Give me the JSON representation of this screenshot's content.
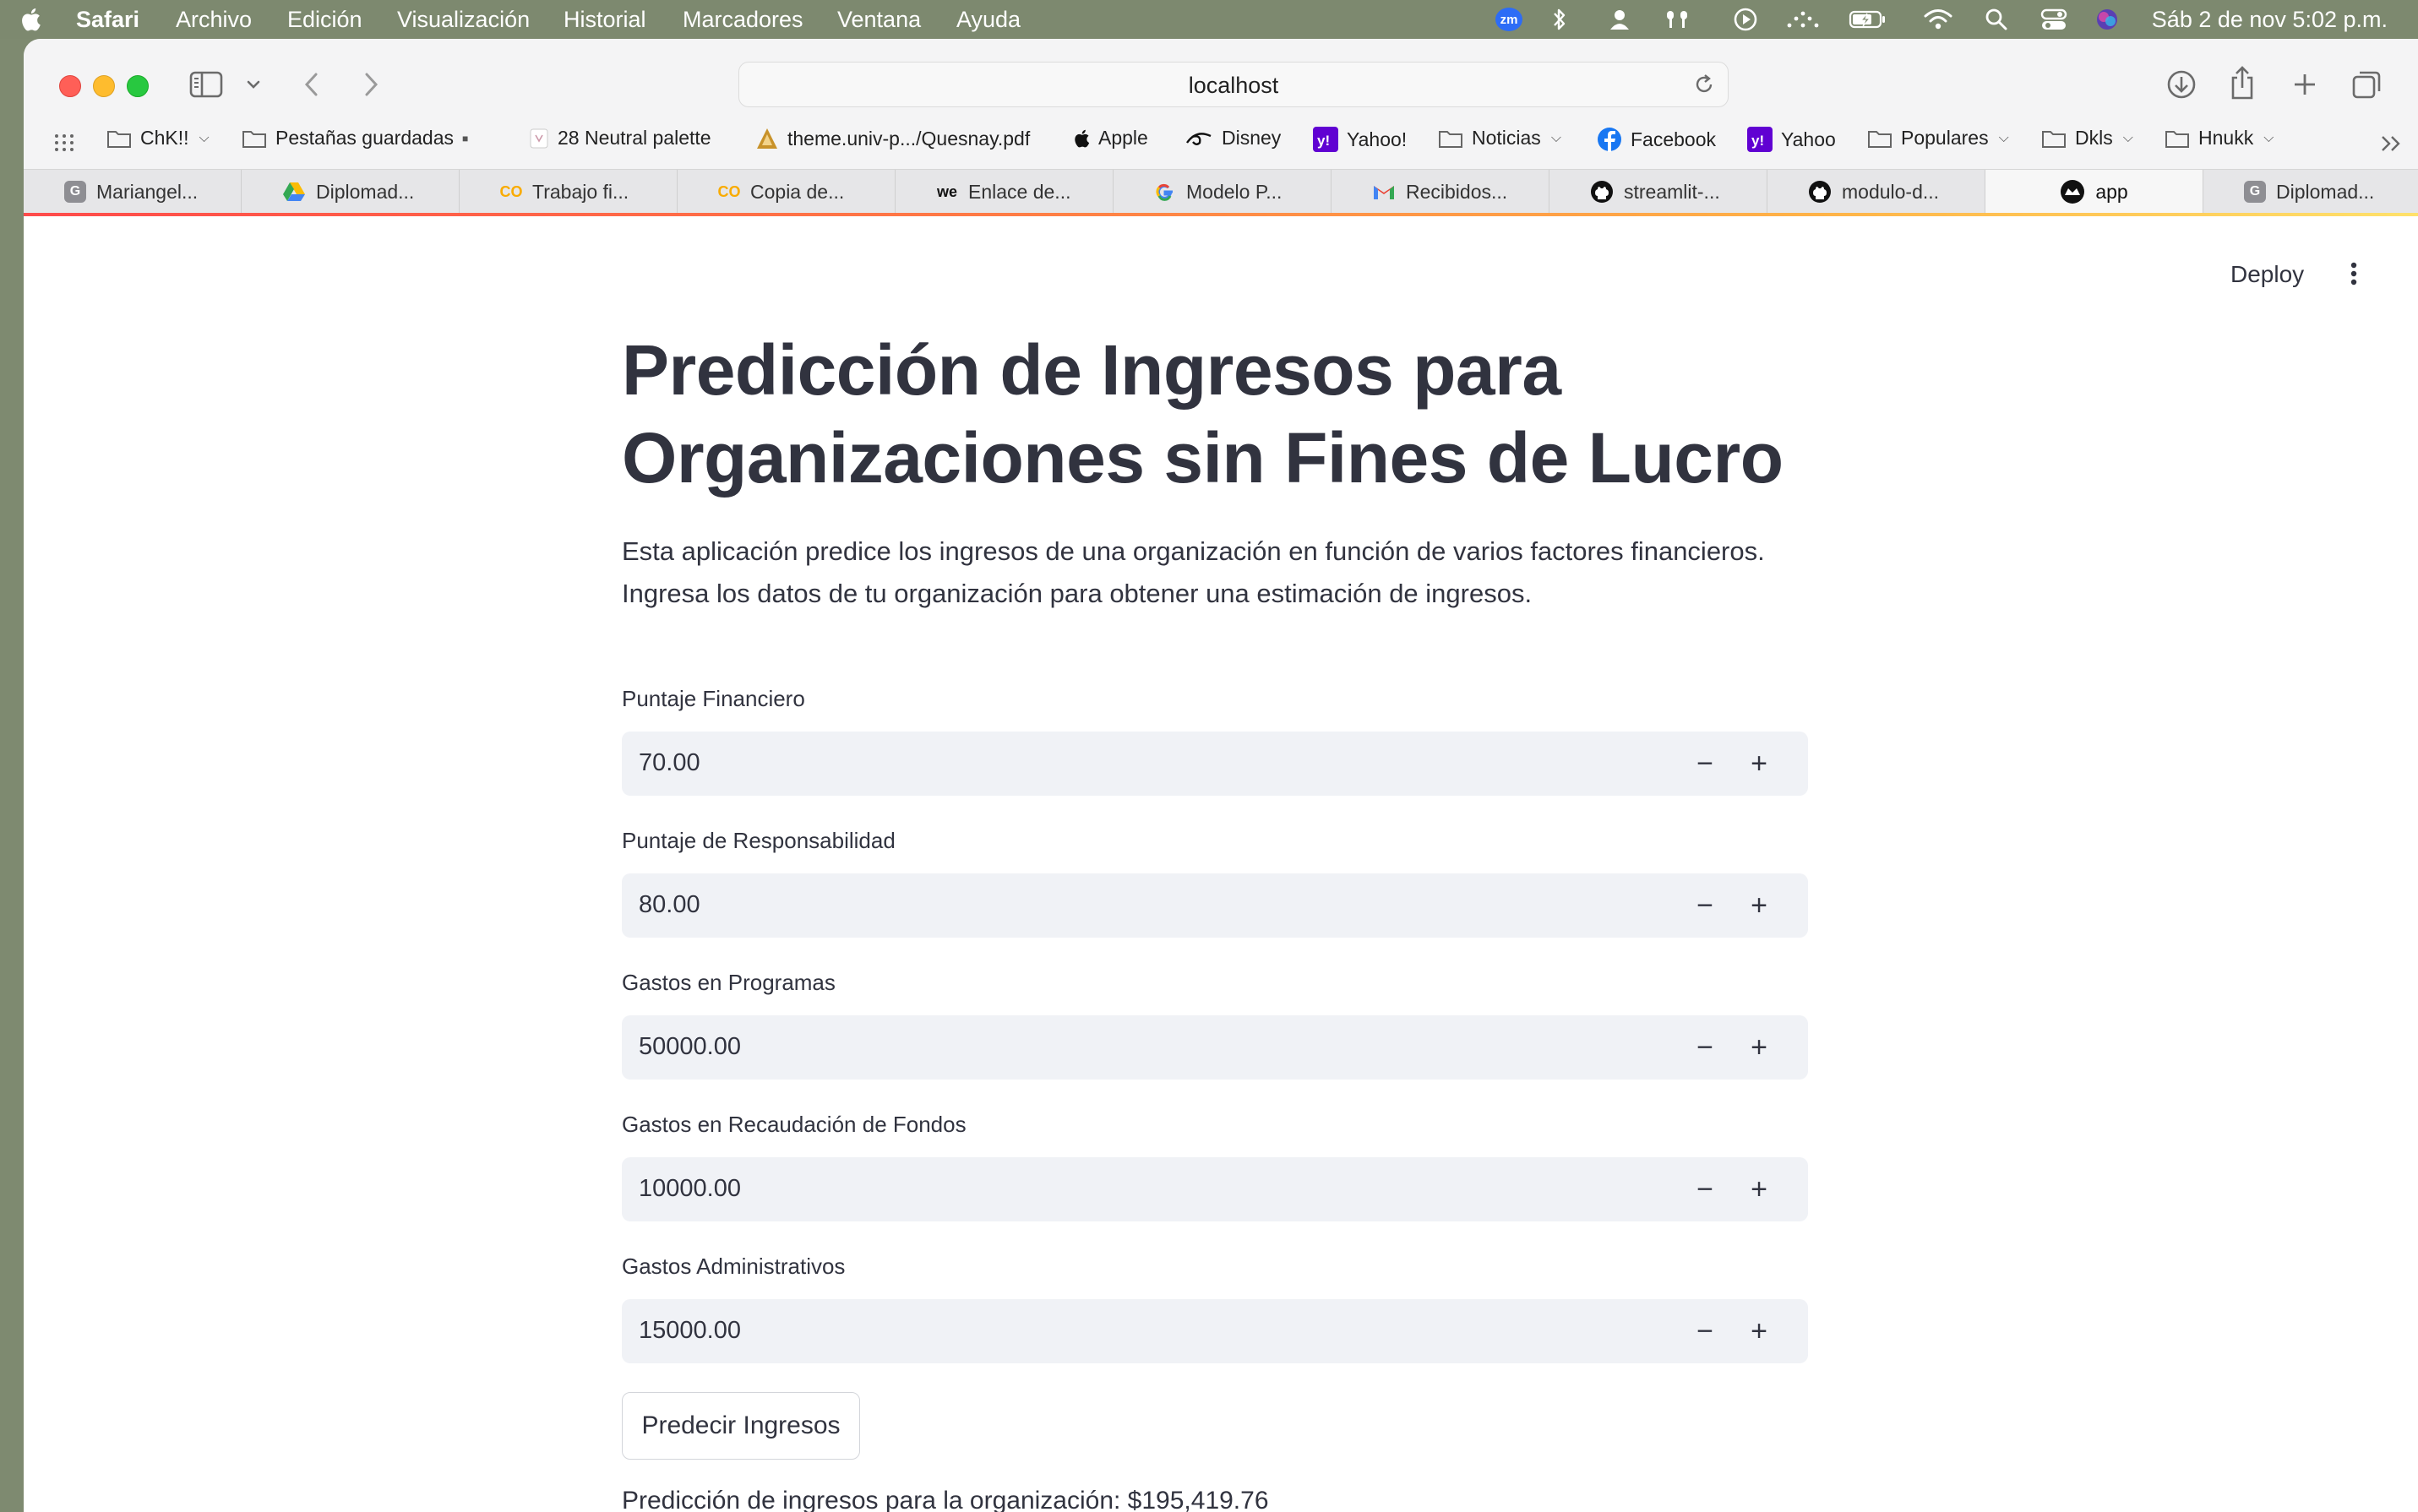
{
  "menubar": {
    "items": [
      "Safari",
      "Archivo",
      "Edición",
      "Visualización",
      "Historial",
      "Marcadores",
      "Ventana",
      "Ayuda"
    ],
    "status_icons": [
      "zoom-icon",
      "bluetooth-icon",
      "user-icon",
      "airpods-icon",
      "play-icon",
      "wifi-dots-icon",
      "battery-icon",
      "wifi-icon",
      "search-icon",
      "control-center-icon",
      "siri-icon"
    ],
    "zoom_badge": "zm",
    "clock": "Sáb 2 de nov  5:02 p.m."
  },
  "browser": {
    "url": "localhost",
    "bookmarks": [
      {
        "label": "ChK!!",
        "icon": "folder-icon",
        "menu": true
      },
      {
        "label": "Pestañas guardadas",
        "icon": "folder-icon",
        "menu": false
      },
      {
        "label": "28 Neutral palette",
        "icon": "palette-icon",
        "menu": false
      },
      {
        "label": "theme.univ-p.../Quesnay.pdf",
        "icon": "pdf-icon",
        "menu": false
      },
      {
        "label": "Apple",
        "icon": "apple-icon",
        "menu": false
      },
      {
        "label": "Disney",
        "icon": "disney-icon",
        "menu": false
      },
      {
        "label": "Yahoo!",
        "icon": "yahoo-icon",
        "menu": false
      },
      {
        "label": "Noticias",
        "icon": "folder-icon",
        "menu": true
      },
      {
        "label": "Facebook",
        "icon": "facebook-icon",
        "menu": false
      },
      {
        "label": "Yahoo",
        "icon": "yahoo-icon",
        "menu": false
      },
      {
        "label": "Populares",
        "icon": "folder-icon",
        "menu": true
      },
      {
        "label": "Dkls",
        "icon": "folder-icon",
        "menu": true
      },
      {
        "label": "Hnukk",
        "icon": "folder-icon",
        "menu": true
      }
    ],
    "tabs": [
      {
        "label": "Mariangel...",
        "favicon": "G"
      },
      {
        "label": "Diplomad...",
        "favicon": "drive"
      },
      {
        "label": "Trabajo fi...",
        "favicon": "CO"
      },
      {
        "label": "Copia de...",
        "favicon": "CO"
      },
      {
        "label": "Enlace de...",
        "favicon": "WE"
      },
      {
        "label": "Modelo P...",
        "favicon": "google"
      },
      {
        "label": "Recibidos...",
        "favicon": "gmail"
      },
      {
        "label": "streamlit-...",
        "favicon": "github"
      },
      {
        "label": "modulo-d...",
        "favicon": "github"
      },
      {
        "label": "app",
        "favicon": "streamlit"
      },
      {
        "label": "Diplomad...",
        "favicon": "G"
      }
    ],
    "active_tab_index": 9
  },
  "app": {
    "deploy_label": "Deploy",
    "title": "Predicción de Ingresos para Organizaciones sin Fines de Lucro",
    "intro": "Esta aplicación predice los ingresos de una organización en función de varios factores financieros. Ingresa los datos de tu organización para obtener una estimación de ingresos.",
    "fields": [
      {
        "label": "Puntaje Financiero",
        "value": "70.00"
      },
      {
        "label": "Puntaje de Responsabilidad",
        "value": "80.00"
      },
      {
        "label": "Gastos en Programas",
        "value": "50000.00"
      },
      {
        "label": "Gastos en Recaudación de Fondos",
        "value": "10000.00"
      },
      {
        "label": "Gastos Administrativos",
        "value": "15000.00"
      }
    ],
    "button_label": "Predecir Ingresos",
    "result": "Predicción de ingresos para la organización: $195,419.76"
  },
  "colors": {
    "menubar_bg": "#7d896f",
    "text": "#31333f",
    "input_bg": "#f0f2f6",
    "accent": "#ff4b4b"
  }
}
